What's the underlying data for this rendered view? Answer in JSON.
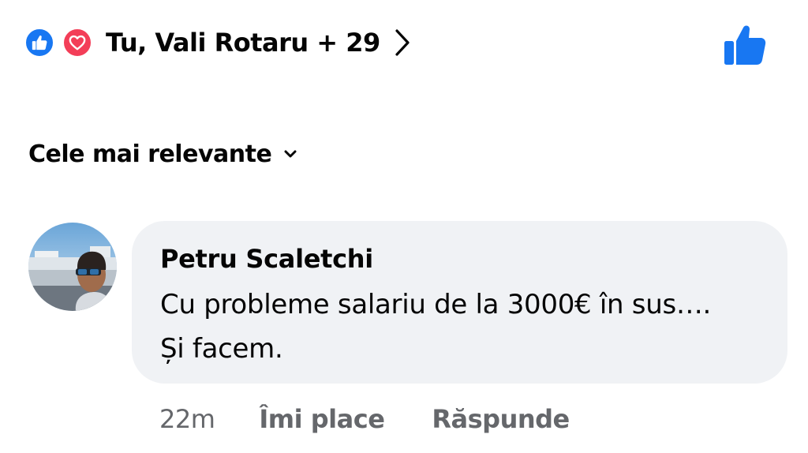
{
  "reactions": {
    "types": [
      "thumbs-up-icon",
      "heart-icon"
    ],
    "summary": "Tu, Vali Rotaru + 29",
    "like_color": "#1877f2",
    "love_color": "#f33e58"
  },
  "sort": {
    "label": "Cele mai relevante"
  },
  "comment": {
    "author": "Petru Scaletchi",
    "text": "Cu probleme salariu de la 3000€ în sus…. Și facem.",
    "time": "22m",
    "like_label": "Îmi place",
    "reply_label": "Răspunde"
  },
  "colors": {
    "bubble": "#f0f2f5",
    "secondary_text": "#65676b",
    "accent": "#1877f2"
  }
}
